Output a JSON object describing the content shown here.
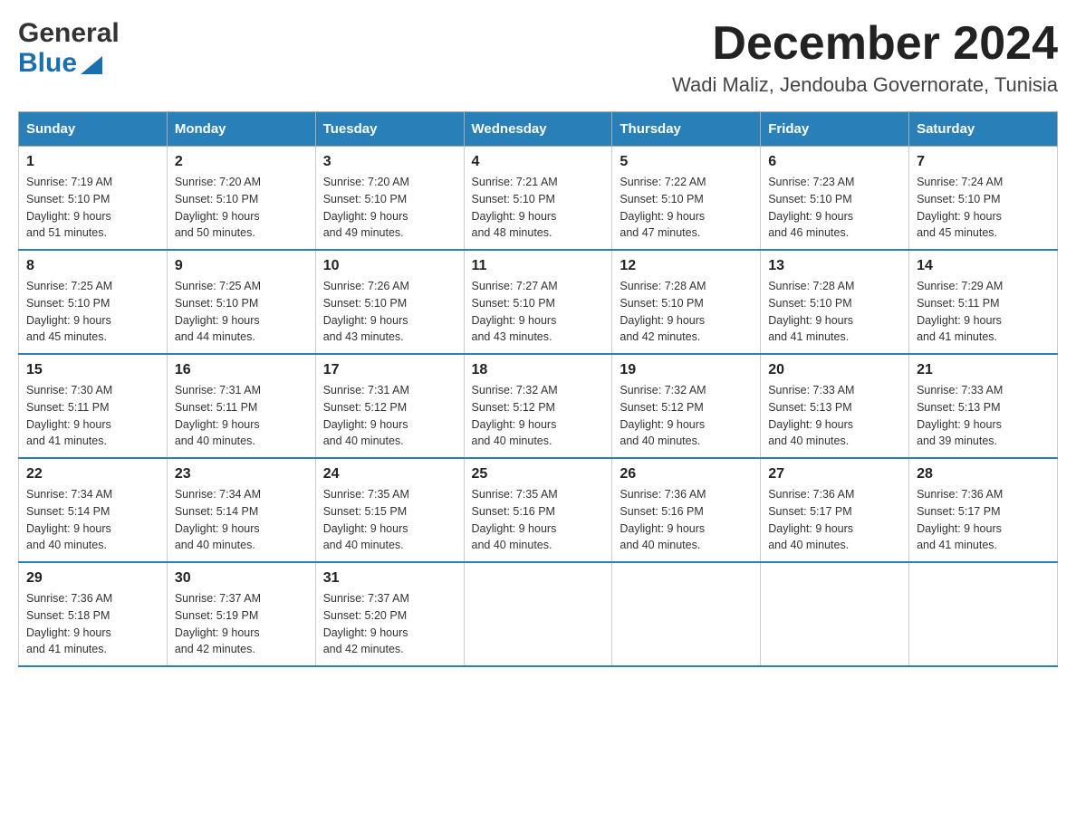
{
  "header": {
    "logo": {
      "general": "General",
      "blue": "Blue"
    },
    "title": "December 2024",
    "location": "Wadi Maliz, Jendouba Governorate, Tunisia"
  },
  "calendar": {
    "days_of_week": [
      "Sunday",
      "Monday",
      "Tuesday",
      "Wednesday",
      "Thursday",
      "Friday",
      "Saturday"
    ],
    "weeks": [
      [
        {
          "day": "1",
          "sunrise": "7:19 AM",
          "sunset": "5:10 PM",
          "daylight": "9 hours and 51 minutes."
        },
        {
          "day": "2",
          "sunrise": "7:20 AM",
          "sunset": "5:10 PM",
          "daylight": "9 hours and 50 minutes."
        },
        {
          "day": "3",
          "sunrise": "7:20 AM",
          "sunset": "5:10 PM",
          "daylight": "9 hours and 49 minutes."
        },
        {
          "day": "4",
          "sunrise": "7:21 AM",
          "sunset": "5:10 PM",
          "daylight": "9 hours and 48 minutes."
        },
        {
          "day": "5",
          "sunrise": "7:22 AM",
          "sunset": "5:10 PM",
          "daylight": "9 hours and 47 minutes."
        },
        {
          "day": "6",
          "sunrise": "7:23 AM",
          "sunset": "5:10 PM",
          "daylight": "9 hours and 46 minutes."
        },
        {
          "day": "7",
          "sunrise": "7:24 AM",
          "sunset": "5:10 PM",
          "daylight": "9 hours and 45 minutes."
        }
      ],
      [
        {
          "day": "8",
          "sunrise": "7:25 AM",
          "sunset": "5:10 PM",
          "daylight": "9 hours and 45 minutes."
        },
        {
          "day": "9",
          "sunrise": "7:25 AM",
          "sunset": "5:10 PM",
          "daylight": "9 hours and 44 minutes."
        },
        {
          "day": "10",
          "sunrise": "7:26 AM",
          "sunset": "5:10 PM",
          "daylight": "9 hours and 43 minutes."
        },
        {
          "day": "11",
          "sunrise": "7:27 AM",
          "sunset": "5:10 PM",
          "daylight": "9 hours and 43 minutes."
        },
        {
          "day": "12",
          "sunrise": "7:28 AM",
          "sunset": "5:10 PM",
          "daylight": "9 hours and 42 minutes."
        },
        {
          "day": "13",
          "sunrise": "7:28 AM",
          "sunset": "5:10 PM",
          "daylight": "9 hours and 41 minutes."
        },
        {
          "day": "14",
          "sunrise": "7:29 AM",
          "sunset": "5:11 PM",
          "daylight": "9 hours and 41 minutes."
        }
      ],
      [
        {
          "day": "15",
          "sunrise": "7:30 AM",
          "sunset": "5:11 PM",
          "daylight": "9 hours and 41 minutes."
        },
        {
          "day": "16",
          "sunrise": "7:31 AM",
          "sunset": "5:11 PM",
          "daylight": "9 hours and 40 minutes."
        },
        {
          "day": "17",
          "sunrise": "7:31 AM",
          "sunset": "5:12 PM",
          "daylight": "9 hours and 40 minutes."
        },
        {
          "day": "18",
          "sunrise": "7:32 AM",
          "sunset": "5:12 PM",
          "daylight": "9 hours and 40 minutes."
        },
        {
          "day": "19",
          "sunrise": "7:32 AM",
          "sunset": "5:12 PM",
          "daylight": "9 hours and 40 minutes."
        },
        {
          "day": "20",
          "sunrise": "7:33 AM",
          "sunset": "5:13 PM",
          "daylight": "9 hours and 40 minutes."
        },
        {
          "day": "21",
          "sunrise": "7:33 AM",
          "sunset": "5:13 PM",
          "daylight": "9 hours and 39 minutes."
        }
      ],
      [
        {
          "day": "22",
          "sunrise": "7:34 AM",
          "sunset": "5:14 PM",
          "daylight": "9 hours and 40 minutes."
        },
        {
          "day": "23",
          "sunrise": "7:34 AM",
          "sunset": "5:14 PM",
          "daylight": "9 hours and 40 minutes."
        },
        {
          "day": "24",
          "sunrise": "7:35 AM",
          "sunset": "5:15 PM",
          "daylight": "9 hours and 40 minutes."
        },
        {
          "day": "25",
          "sunrise": "7:35 AM",
          "sunset": "5:16 PM",
          "daylight": "9 hours and 40 minutes."
        },
        {
          "day": "26",
          "sunrise": "7:36 AM",
          "sunset": "5:16 PM",
          "daylight": "9 hours and 40 minutes."
        },
        {
          "day": "27",
          "sunrise": "7:36 AM",
          "sunset": "5:17 PM",
          "daylight": "9 hours and 40 minutes."
        },
        {
          "day": "28",
          "sunrise": "7:36 AM",
          "sunset": "5:17 PM",
          "daylight": "9 hours and 41 minutes."
        }
      ],
      [
        {
          "day": "29",
          "sunrise": "7:36 AM",
          "sunset": "5:18 PM",
          "daylight": "9 hours and 41 minutes."
        },
        {
          "day": "30",
          "sunrise": "7:37 AM",
          "sunset": "5:19 PM",
          "daylight": "9 hours and 42 minutes."
        },
        {
          "day": "31",
          "sunrise": "7:37 AM",
          "sunset": "5:20 PM",
          "daylight": "9 hours and 42 minutes."
        },
        null,
        null,
        null,
        null
      ]
    ]
  }
}
